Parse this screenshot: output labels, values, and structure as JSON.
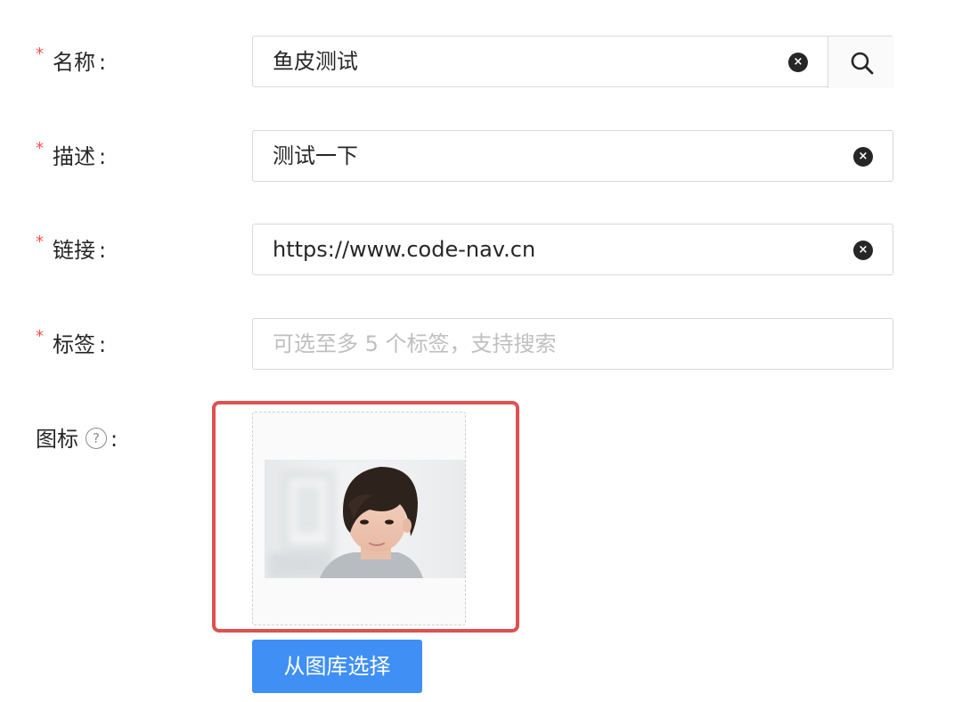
{
  "form": {
    "required_mark": "*",
    "colon": ":",
    "name": {
      "label": "名称",
      "value": "鱼皮测试",
      "clear_icon": "close-circle-icon",
      "search_icon": "search-icon"
    },
    "description": {
      "label": "描述",
      "value": "测试一下",
      "clear_icon": "close-circle-icon"
    },
    "link": {
      "label": "链接",
      "value": "https://www.code-nav.cn",
      "clear_icon": "close-circle-icon"
    },
    "tags": {
      "label": "标签",
      "placeholder": "可选至多 5 个标签，支持搜索"
    },
    "icon": {
      "label": "图标",
      "help_icon": "question-circle-icon",
      "help_glyph": "?",
      "picker_button": "从图库选择"
    }
  },
  "colors": {
    "required": "#ff4d4f",
    "primary_button": "#3f8ff5",
    "highlight_border": "#e05050"
  }
}
